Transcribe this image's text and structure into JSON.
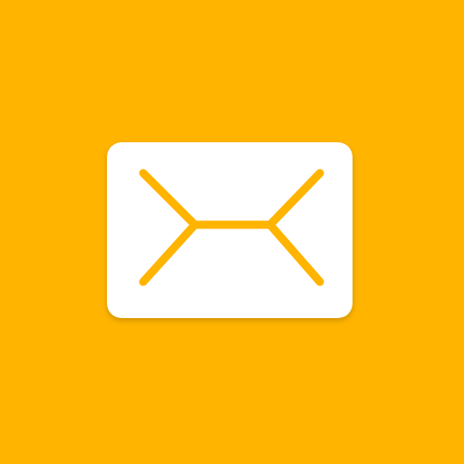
{
  "icon": {
    "name": "mail-icon",
    "background_color": "#FFB400",
    "envelope_color": "#FFFFFF",
    "line_color": "#FFB400"
  }
}
